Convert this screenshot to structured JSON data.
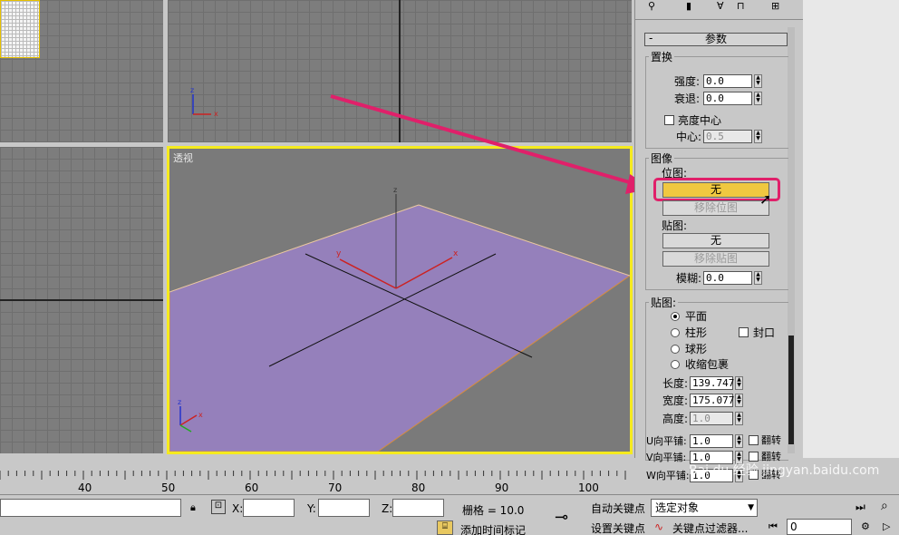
{
  "viewports": {
    "perspective_label": "透视"
  },
  "panel": {
    "rollout_title": "参数",
    "displace_group": "置换",
    "strength_label": "强度:",
    "strength_value": "0.0",
    "decay_label": "衰退:",
    "decay_value": "0.0",
    "luminance_center_label": "亮度中心",
    "center_label": "中心:",
    "center_value": "0.5",
    "image_group": "图像",
    "bitmap_label": "位图:",
    "bitmap_button": "无",
    "remove_bitmap_button": "移除位图",
    "map_label": "贴图:",
    "map_button": "无",
    "remove_map_button": "移除贴图",
    "blur_label": "模糊:",
    "blur_value": "0.0",
    "mapping_group": "贴图:",
    "mapping_options": [
      "平面",
      "柱形",
      "球形",
      "收缩包裹"
    ],
    "cap_label": "封口",
    "length_label": "长度:",
    "length_value": "139.747",
    "width_label": "宽度:",
    "width_value": "175.077",
    "height_label": "高度:",
    "height_value": "1.0",
    "u_tile_label": "U向平铺:",
    "u_tile_value": "1.0",
    "v_tile_label": "V向平铺:",
    "v_tile_value": "1.0",
    "w_tile_label": "W向平铺:",
    "w_tile_value": "1.0",
    "flip_label": "翻转"
  },
  "timeline": {
    "ticks": [
      "40",
      "50",
      "60",
      "70",
      "80",
      "90",
      "100"
    ]
  },
  "status": {
    "x_label": "X:",
    "y_label": "Y:",
    "z_label": "Z:",
    "grid_text": "栅格 = 10.0",
    "auto_key": "自动关键点",
    "set_key": "设置关键点",
    "selected_object": "选定对象",
    "key_filters": "关键点过滤器...",
    "add_time_tag": "添加时间标记",
    "frame_value": "0"
  },
  "watermark": "Bai du 经验 jingyan.baidu.com",
  "colors": {
    "viewport_border_active": "#f5ea1e",
    "plane_fill": "#9580bb",
    "callout_arrow": "#e0206a",
    "highlight_button": "#f0c840"
  }
}
